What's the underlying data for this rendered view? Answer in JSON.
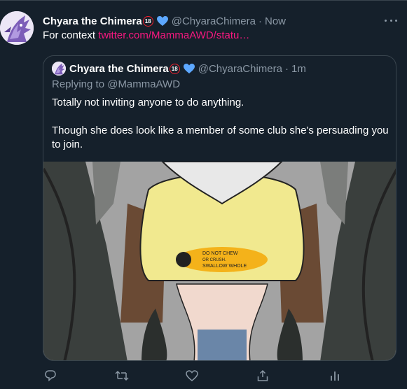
{
  "tweet": {
    "author_name": "Chyara the Chimera",
    "age_badge": "18",
    "handle": "@ChyaraChimera",
    "separator": "·",
    "time": "Now",
    "text_prefix": "For context",
    "link_text": "twitter.com/MammaAWD/statu…"
  },
  "quote": {
    "author_name": "Chyara the Chimera",
    "age_badge": "18",
    "handle": "@ChyaraChimera",
    "separator": "·",
    "time": "1m",
    "replying_to": "Replying to @MammaAWD",
    "paragraph_1": "Totally not inviting anyone to do anything.",
    "paragraph_2": "Though she does look like a member of some club she's persuading you to join.",
    "image": {
      "sign_line_1": "DO NOT CHEW",
      "sign_line_2": "OR CRUSH.",
      "sign_line_3": "SWALLOW WHOLE"
    }
  },
  "actions": [
    "reply-icon",
    "retweet-icon",
    "like-icon",
    "share-icon",
    "analytics-icon"
  ],
  "colors": {
    "background": "#15202b",
    "border": "#38444d",
    "secondary_text": "#8b98a5",
    "link": "#f91880",
    "heart": "#5da8ff",
    "badge": "#f4212e"
  }
}
